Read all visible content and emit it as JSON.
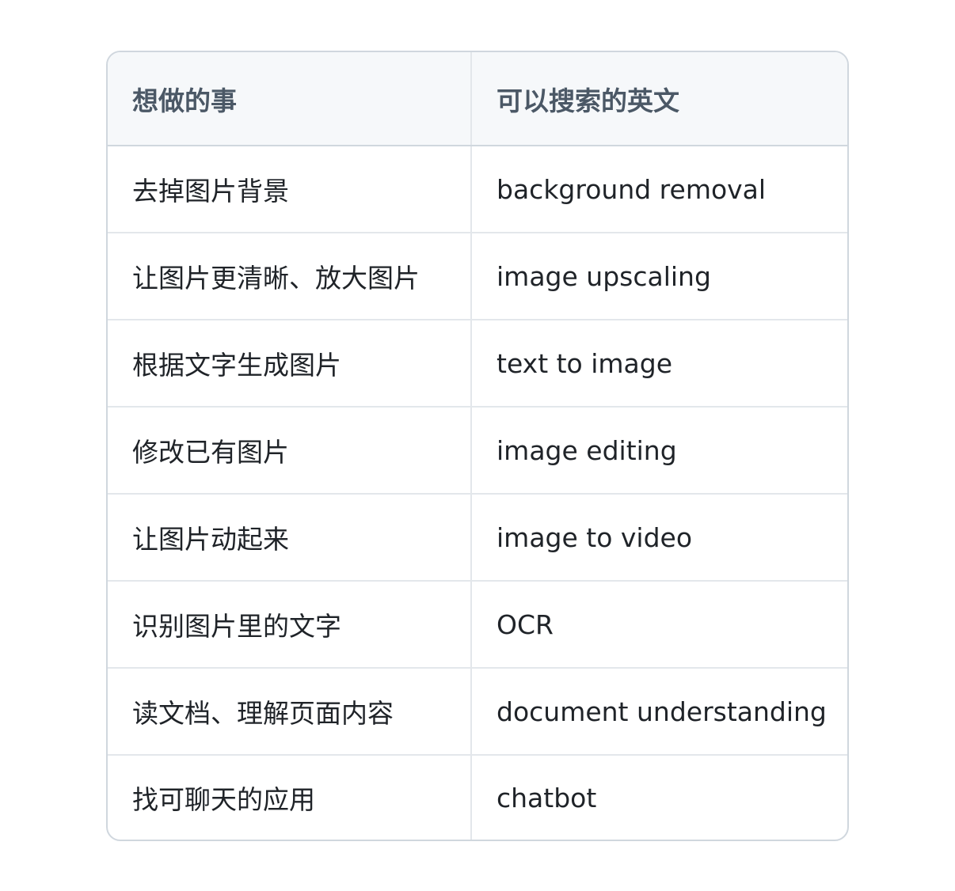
{
  "table": {
    "headers": [
      "想做的事",
      "可以搜索的英文"
    ],
    "rows": [
      [
        "去掉图片背景",
        "background removal"
      ],
      [
        "让图片更清晰、放大图片",
        "image upscaling"
      ],
      [
        "根据文字生成图片",
        "text to image"
      ],
      [
        "修改已有图片",
        "image editing"
      ],
      [
        "让图片动起来",
        "image to video"
      ],
      [
        "识别图片里的文字",
        "OCR"
      ],
      [
        "读文档、理解页面内容",
        "document understanding"
      ],
      [
        "找可聊天的应用",
        "chatbot"
      ]
    ]
  }
}
